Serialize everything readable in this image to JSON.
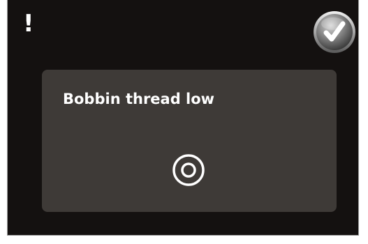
{
  "status": {
    "alert_glyph": "!",
    "alert_icon": "exclamation-icon"
  },
  "confirm_button": {
    "icon": "checkmark-icon"
  },
  "dialog": {
    "message": "Bobbin thread low",
    "icon": "bobbin-icon"
  },
  "colors": {
    "screen_background": "#141110",
    "dialog_background": "#3e3a37",
    "text": "#ffffff"
  }
}
